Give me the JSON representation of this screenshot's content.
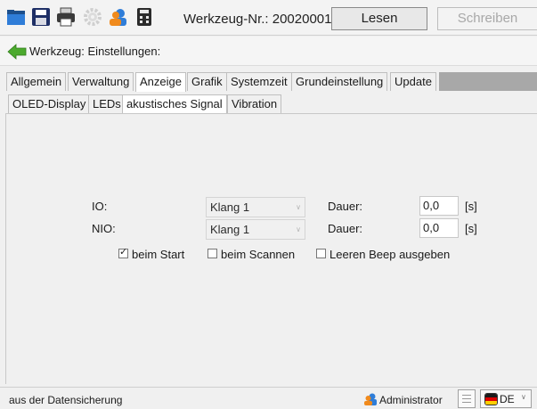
{
  "toolbar": {
    "icons": [
      "folder-open-icon",
      "save-disk-icon",
      "print-icon",
      "gear-icon",
      "user-icon",
      "calculator-icon"
    ],
    "tool_number_label": "Werkzeug-Nr.: 20020001",
    "read_label": "Lesen",
    "write_label": "Schreiben"
  },
  "breadcrumb": {
    "text": "Werkzeug: Einstellungen:"
  },
  "main_tabs": [
    {
      "label": "Allgemein",
      "active": false
    },
    {
      "label": "Verwaltung",
      "active": false
    },
    {
      "label": "Anzeige",
      "active": true
    },
    {
      "label": "Grafik",
      "active": false
    },
    {
      "label": "Systemzeit",
      "active": false
    },
    {
      "label": "Grundeinstellung",
      "active": false
    },
    {
      "label": "Update",
      "active": false
    }
  ],
  "sub_tabs": [
    {
      "label": "OLED-Display",
      "active": false
    },
    {
      "label": "LEDs",
      "active": false
    },
    {
      "label": "akustisches Signal",
      "active": true
    },
    {
      "label": "Vibration",
      "active": false
    }
  ],
  "signal": {
    "io": {
      "label": "IO:",
      "sound": "Klang 1",
      "duration_label": "Dauer:",
      "duration": "0,0",
      "unit": "[s]"
    },
    "nio": {
      "label": "NIO:",
      "sound": "Klang 1",
      "duration_label": "Dauer:",
      "duration": "0,0",
      "unit": "[s]"
    },
    "options": [
      {
        "label": "beim Start",
        "checked": true
      },
      {
        "label": "beim Scannen",
        "checked": false
      },
      {
        "label": "Leeren Beep ausgeben",
        "checked": false
      }
    ]
  },
  "status": {
    "text": "aus der Datensicherung",
    "user": "Administrator",
    "language": "DE"
  },
  "colors": {
    "panel_bg": "#f0f0f0",
    "tab_strip": "#a8a8a8",
    "back_arrow": "#4caa2e",
    "user_icon": "#f08a1c"
  }
}
